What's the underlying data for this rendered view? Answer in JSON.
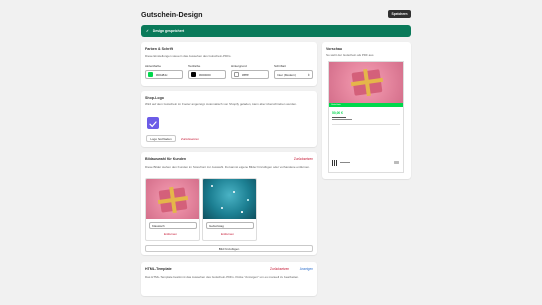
{
  "page": {
    "title": "Gutschein-Design",
    "save_label": "Speichern"
  },
  "banner": {
    "icon": "checkmark-icon",
    "text": "Design gespeichert",
    "color": "#0a7a5a"
  },
  "colors_card": {
    "title": "Farben & Schrift",
    "description": "Diese Einstellungen steuern das Aussehen des Gutschein-PDFs.",
    "accent": {
      "label": "Akzentfarbe",
      "value": "#00d84c",
      "swatch": "#00d84c"
    },
    "text": {
      "label": "Textfarbe",
      "value": "#000000",
      "swatch": "#000000"
    },
    "background": {
      "label": "Hintergrund",
      "value": "#ffffff",
      "swatch": "#ffffff"
    },
    "font": {
      "label": "Schriftart",
      "value": "Inter (Modern)"
    }
  },
  "logo_card": {
    "title": "Shop-Logo",
    "description": "Wird auf dem Gutschein im Footer angezeigt. Automatisch von Shopify geladen, kann aber überschrieben werden.",
    "upload_label": "Logo hochladen",
    "reset_label": "Zurücksetzen"
  },
  "images_card": {
    "title": "Bildauswahl für Kunden",
    "reset_label": "Zurücksetzen",
    "description": "Diese Bilder stehen den Kunden im Storefront zur Auswahl. Du kannst eigene Bilder hinzufügen oder vorhandene entfernen.",
    "images": [
      {
        "name": "Klassisch",
        "remove_label": "Entfernen"
      },
      {
        "name": "Geburtstag",
        "remove_label": "Entfernen"
      }
    ],
    "add_label": "Bild hinzufügen"
  },
  "html_card": {
    "title": "HTML-Template",
    "reset_label": "Zurücksetzen",
    "show_label": "Anzeigen",
    "description": "Das HTML-Template bestimmt das Aussehen des Gutschein-PDFs. Klicke \"Anzeigen\" um es manuell zu bearbeiten."
  },
  "preview_card": {
    "title": "Vorschau",
    "description": "So sieht der Gutschein als PDF aus",
    "amount": "50,00 €",
    "bar_label": "Gutschein"
  }
}
